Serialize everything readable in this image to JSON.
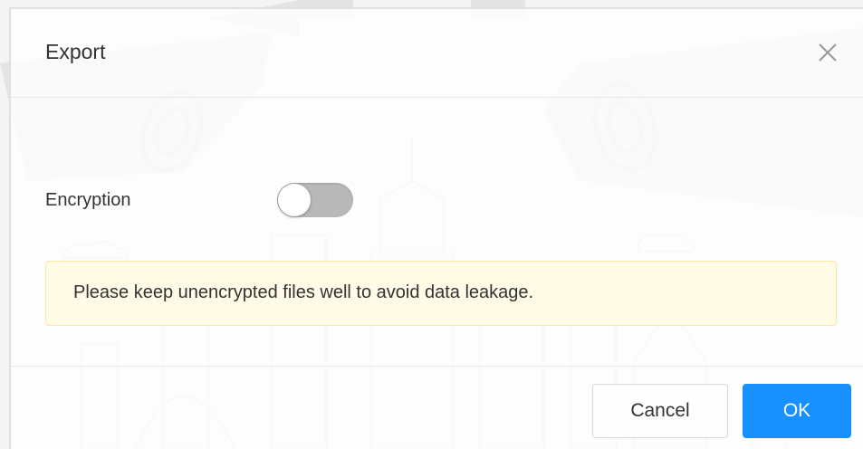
{
  "dialog": {
    "title": "Export",
    "close_icon": "close-icon"
  },
  "encryption": {
    "label": "Encryption",
    "enabled": false
  },
  "alert": {
    "message": "Please keep unencrypted files well to avoid data leakage."
  },
  "footer": {
    "cancel_label": "Cancel",
    "ok_label": "OK"
  },
  "colors": {
    "primary": "#1890ff",
    "alert_background": "#fffbe6",
    "alert_border": "#fce5a6",
    "toggle_off": "#b8b8b8"
  }
}
